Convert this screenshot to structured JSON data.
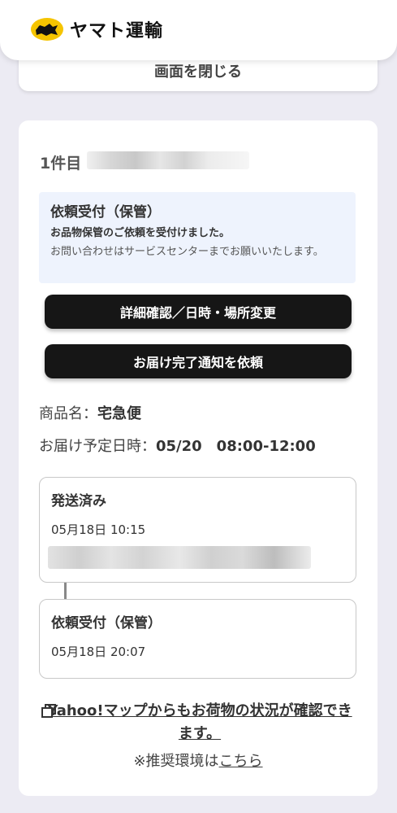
{
  "header": {
    "logo_text": "ヤマト運輸"
  },
  "close_label": "画面を閉じる",
  "item": {
    "title": "1件目"
  },
  "status": {
    "title": "依頼受付（保管）",
    "line1": "お品物保管のご依頼を受付けました。",
    "line2": "お問い合わせはサービスセンターまでお願いいたします。"
  },
  "buttons": {
    "detail": "詳細確認／日時・場所変更",
    "notify": "お届け完了通知を依頼"
  },
  "product": {
    "label": "商品名：",
    "value": "宅急便"
  },
  "delivery": {
    "label": "お届け予定日時：",
    "value": "05/20　08:00-12:00"
  },
  "tracking": [
    {
      "title": "発送済み",
      "date": "05月18日 10:15"
    },
    {
      "title": "依頼受付（保管）",
      "date": "05月18日 20:07"
    }
  ],
  "yahoo_link": "Yahoo!マップからもお荷物の状況が確認できます。",
  "note": {
    "prefix": "※推奨環境は",
    "link": "こちら"
  },
  "colors": {
    "background": "#ecebf3",
    "button": "#161616",
    "status_bg": "#eef3fd",
    "logo_yellow": "#f5c400"
  }
}
